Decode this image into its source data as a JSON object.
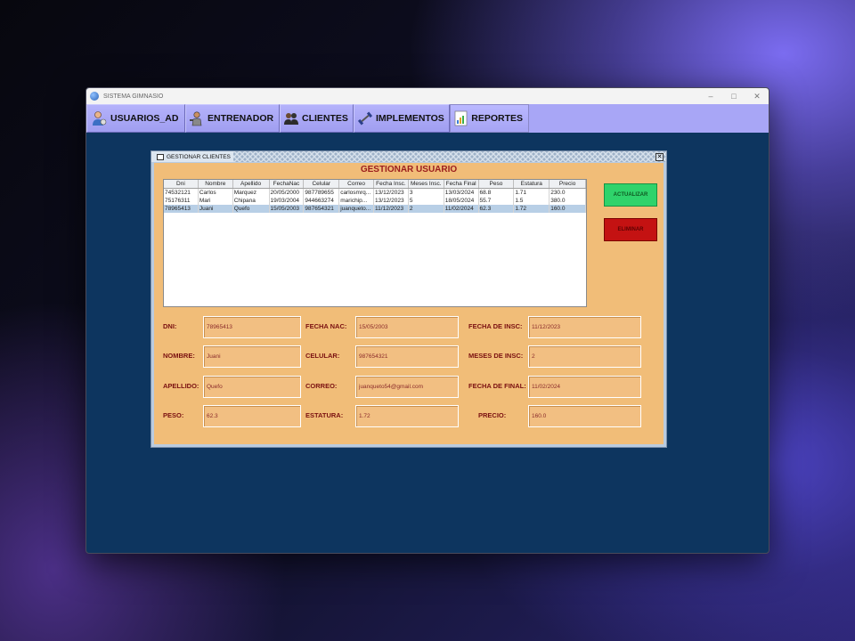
{
  "window": {
    "title": "SISTEMA GIMNASIO"
  },
  "menu": {
    "items": [
      {
        "label": "USUARIOS_AD",
        "icon": "user-admin-icon"
      },
      {
        "label": "ENTRENADOR",
        "icon": "trainer-icon"
      },
      {
        "label": "CLIENTES",
        "icon": "clients-icon"
      },
      {
        "label": "IMPLEMENTOS",
        "icon": "dumbbell-icon"
      },
      {
        "label": "REPORTES",
        "icon": "report-icon"
      }
    ]
  },
  "internal_frame": {
    "title": "GESTIONAR CLIENTES",
    "heading": "GESTIONAR USUARIO"
  },
  "table": {
    "headers": [
      "Dni",
      "Nombre",
      "Apellido",
      "FechaNac",
      "Celular",
      "Correo",
      "Fecha Insc.",
      "Meses Insc.",
      "Fecha Final",
      "Peso",
      "Estatura",
      "Precio"
    ],
    "rows": [
      [
        "74532121",
        "Carlos",
        "Marquez",
        "20/05/2000",
        "987789655",
        "carlosmrq...",
        "13/12/2023",
        "3",
        "13/03/2024",
        "68.8",
        "1.71",
        "230.0"
      ],
      [
        "75176311",
        "Mari",
        "Chipana",
        "19/03/2004",
        "944663274",
        "marichip...",
        "13/12/2023",
        "5",
        "18/05/2024",
        "55.7",
        "1.5",
        "380.0"
      ],
      [
        "78965413",
        "Juani",
        "Quefo",
        "15/05/2003",
        "987654321",
        "juanqueto...",
        "11/12/2023",
        "2",
        "11/02/2024",
        "62.3",
        "1.72",
        "160.0"
      ]
    ],
    "selected_row": 2
  },
  "buttons": {
    "update": "ACTUALIZAR",
    "delete": "ELIMINAR"
  },
  "form": {
    "dni": {
      "label": "DNI:",
      "value": "78965413"
    },
    "nombre": {
      "label": "NOMBRE:",
      "value": "Juani"
    },
    "apellido": {
      "label": "APELLIDO:",
      "value": "Quefo"
    },
    "peso": {
      "label": "PESO:",
      "value": "62.3"
    },
    "fecha_nac": {
      "label": "FECHA NAC:",
      "value": "15/05/2003"
    },
    "celular": {
      "label": "CELULAR:",
      "value": "987654321"
    },
    "correo": {
      "label": "CORREO:",
      "value": "juanqueto54@gmail.com"
    },
    "estatura": {
      "label": "ESTATURA:",
      "value": "1.72"
    },
    "fecha_insc": {
      "label": "FECHA DE INSC:",
      "value": "11/12/2023"
    },
    "meses_insc": {
      "label": "MESES DE INSC:",
      "value": "2"
    },
    "fecha_final": {
      "label": "FECHA DE FINAL:",
      "value": "11/02/2024"
    },
    "precio": {
      "label": "PRECIO:",
      "value": "160.0"
    }
  },
  "colors": {
    "desktop_bg": "#0d355f",
    "menubar": "#a8a6f6",
    "panel": "#f1bd78",
    "label_text": "#7a1010",
    "update_button": "#2fd36b",
    "delete_button": "#c41212"
  }
}
